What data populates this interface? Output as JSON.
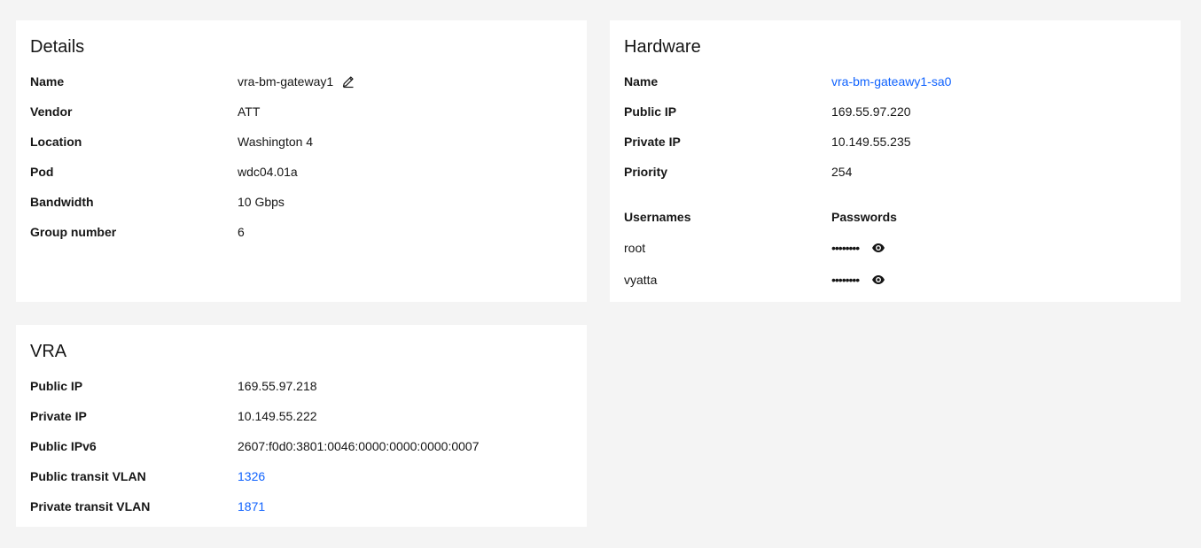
{
  "details": {
    "title": "Details",
    "rows": [
      {
        "label": "Name",
        "value": "vra-bm-gateway1"
      },
      {
        "label": "Vendor",
        "value": "ATT"
      },
      {
        "label": "Location",
        "value": "Washington 4"
      },
      {
        "label": "Pod",
        "value": "wdc04.01a"
      },
      {
        "label": "Bandwidth",
        "value": "10 Gbps"
      },
      {
        "label": "Group number",
        "value": "6"
      }
    ],
    "edit_icon": "pencil-icon"
  },
  "hardware": {
    "title": "Hardware",
    "rows": [
      {
        "label": "Name",
        "value": "vra-bm-gateawy1-sa0"
      },
      {
        "label": "Public IP",
        "value": "169.55.97.220"
      },
      {
        "label": "Private IP",
        "value": "10.149.55.235"
      },
      {
        "label": "Priority",
        "value": "254"
      }
    ],
    "credentials": {
      "usernames_header": "Usernames",
      "passwords_header": "Passwords",
      "rows": [
        {
          "username": "root",
          "password": "••••••••"
        },
        {
          "username": "vyatta",
          "password": "••••••••"
        }
      ],
      "reveal_icon": "eye-icon"
    }
  },
  "vra": {
    "title": "VRA",
    "rows": [
      {
        "label": "Public IP",
        "value": "169.55.97.218"
      },
      {
        "label": "Private IP",
        "value": "10.149.55.222"
      },
      {
        "label": "Public IPv6",
        "value": "2607:f0d0:3801:0046:0000:0000:0000:0007"
      },
      {
        "label": "Public transit VLAN",
        "value": "1326"
      },
      {
        "label": "Private transit VLAN",
        "value": "1871"
      }
    ]
  },
  "colors": {
    "background": "#f4f4f4",
    "card": "#ffffff",
    "text": "#161616",
    "link": "#0f62fe"
  }
}
